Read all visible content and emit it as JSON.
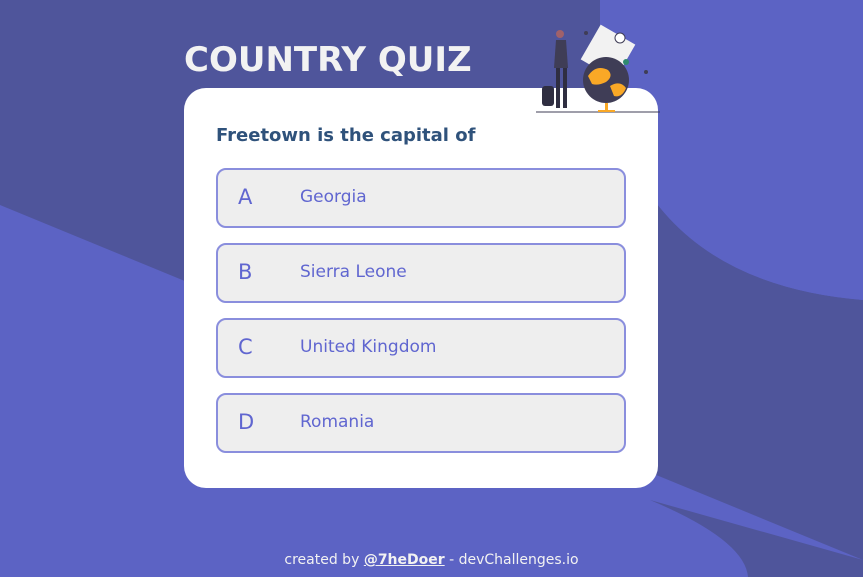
{
  "app": {
    "title": "COUNTRY QUIZ"
  },
  "quiz": {
    "question": "Freetown is the capital of",
    "options": [
      {
        "letter": "A",
        "answer": "Georgia"
      },
      {
        "letter": "B",
        "answer": "Sierra Leone"
      },
      {
        "letter": "C",
        "answer": "United Kingdom"
      },
      {
        "letter": "D",
        "answer": "Romania"
      }
    ]
  },
  "footer": {
    "prefix": "created by",
    "author": "@7heDoer",
    "suffix": "- devChallenges.io"
  },
  "colors": {
    "background": "#5c63c4",
    "background_dark": "#4f559b",
    "title": "#f2f2f2",
    "question": "#2f527b",
    "option_text": "#6066d0",
    "option_border": "#8a8edd",
    "option_bg": "#eeeeee"
  },
  "icons": {
    "illustration": "adventure-globe-illustration"
  }
}
